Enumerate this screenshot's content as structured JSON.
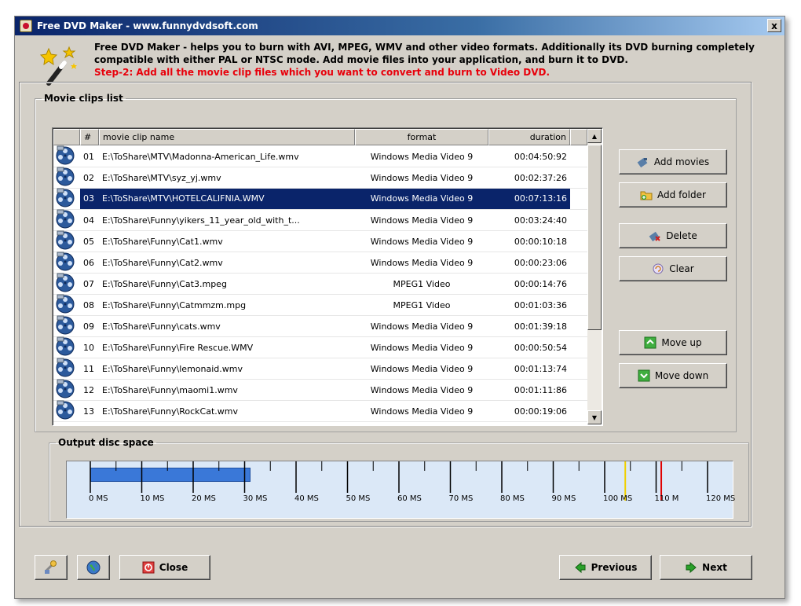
{
  "window": {
    "title": "Free DVD Maker - www.funnydvdsoft.com",
    "close_glyph": "x"
  },
  "header": {
    "description": "Free DVD Maker - helps you to burn with AVI, MPEG, WMV and other video formats. Additionally its DVD burning completely compatible with either PAL or NTSC mode. Add movie files into your application, and burn it to DVD.",
    "step": "Step-2: Add all the movie clip files which you want to convert and burn to Video DVD."
  },
  "clips_group": {
    "legend": "Movie clips list",
    "columns": {
      "num": "#",
      "name": "movie clip name",
      "format": "format",
      "duration": "duration"
    },
    "rows": [
      {
        "num": "01",
        "name": "E:\\ToShare\\MTV\\Madonna-American_Life.wmv",
        "format": "Windows Media Video 9",
        "duration": "00:04:50:92",
        "selected": false
      },
      {
        "num": "02",
        "name": "E:\\ToShare\\MTV\\syz_yj.wmv",
        "format": "Windows Media Video 9",
        "duration": "00:02:37:26",
        "selected": false
      },
      {
        "num": "03",
        "name": "E:\\ToShare\\MTV\\HOTELCALIFNIA.WMV",
        "format": "Windows Media Video 9",
        "duration": "00:07:13:16",
        "selected": true
      },
      {
        "num": "04",
        "name": "E:\\ToShare\\Funny\\yikers_11_year_old_with_t...",
        "format": "Windows Media Video 9",
        "duration": "00:03:24:40",
        "selected": false
      },
      {
        "num": "05",
        "name": "E:\\ToShare\\Funny\\Cat1.wmv",
        "format": "Windows Media Video 9",
        "duration": "00:00:10:18",
        "selected": false
      },
      {
        "num": "06",
        "name": "E:\\ToShare\\Funny\\Cat2.wmv",
        "format": "Windows Media Video 9",
        "duration": "00:00:23:06",
        "selected": false
      },
      {
        "num": "07",
        "name": "E:\\ToShare\\Funny\\Cat3.mpeg",
        "format": "MPEG1 Video",
        "duration": "00:00:14:76",
        "selected": false
      },
      {
        "num": "08",
        "name": "E:\\ToShare\\Funny\\Catmmzm.mpg",
        "format": "MPEG1 Video",
        "duration": "00:01:03:36",
        "selected": false
      },
      {
        "num": "09",
        "name": "E:\\ToShare\\Funny\\cats.wmv",
        "format": "Windows Media Video 9",
        "duration": "00:01:39:18",
        "selected": false
      },
      {
        "num": "10",
        "name": "E:\\ToShare\\Funny\\Fire Rescue.WMV",
        "format": "Windows Media Video 9",
        "duration": "00:00:50:54",
        "selected": false
      },
      {
        "num": "11",
        "name": "E:\\ToShare\\Funny\\lemonaid.wmv",
        "format": "Windows Media Video 9",
        "duration": "00:01:13:74",
        "selected": false
      },
      {
        "num": "12",
        "name": "E:\\ToShare\\Funny\\maomi1.wmv",
        "format": "Windows Media Video 9",
        "duration": "00:01:11:86",
        "selected": false
      },
      {
        "num": "13",
        "name": "E:\\ToShare\\Funny\\RockCat.wmv",
        "format": "Windows Media Video 9",
        "duration": "00:00:19:06",
        "selected": false
      }
    ]
  },
  "side_buttons": {
    "add_movies": "Add movies",
    "add_folder": "Add folder",
    "delete": "Delete",
    "clear": "Clear",
    "move_up": "Move up",
    "move_down": "Move down"
  },
  "disc_group": {
    "legend": "Output disc space",
    "used_fraction_of_scale": 0.26,
    "tick_labels": [
      "0 MS",
      "10 MS",
      "20 MS",
      "30 MS",
      "40 MS",
      "50 MS",
      "60 MS",
      "70 MS",
      "80 MS",
      "90 MS",
      "100 MS",
      "110 M",
      "120 MS"
    ],
    "warning_marker_color": "#f0d000",
    "limit_marker_color": "#e00000",
    "fill_color": "#3a78d8"
  },
  "bottom_buttons": {
    "close": "Close",
    "previous": "Previous",
    "next": "Next"
  },
  "colors": {
    "selection": "#0a246a",
    "step_text": "#e8000b",
    "window_face": "#d4d0c8"
  }
}
